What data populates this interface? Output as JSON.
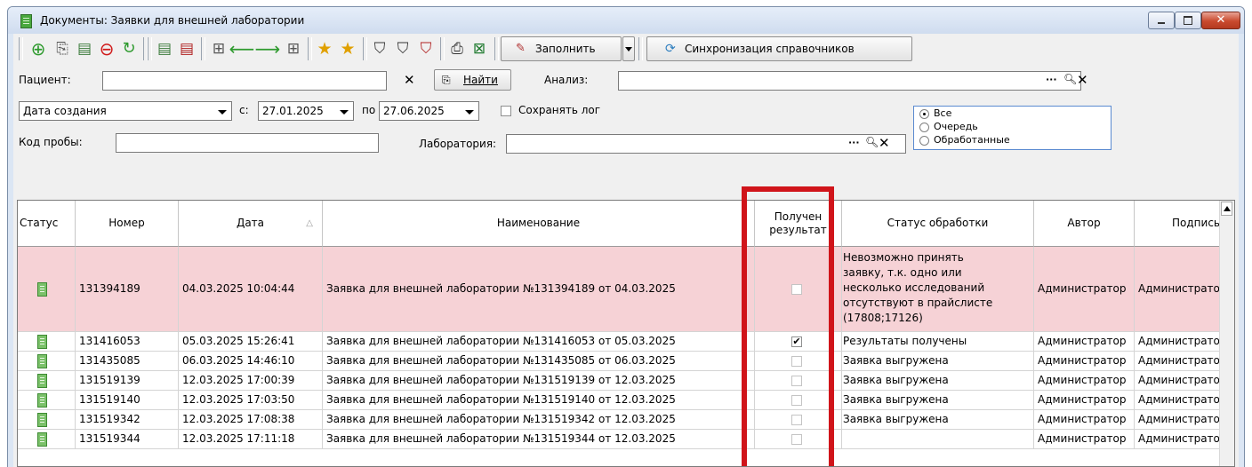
{
  "window": {
    "title": "Документы: Заявки для внешней лаборатории",
    "close_glyph": "✕"
  },
  "toolbar": {
    "fill_label": "Заполнить",
    "sync_label": "Синхронизация справочников"
  },
  "filters": {
    "patient_label": "Пациент:",
    "find_label": "Найти",
    "analysis_label": "Анализ:",
    "date_type": "Дата создания",
    "from_label": "с:",
    "from_date": "27.01.2025",
    "to_label": "по",
    "to_date": "27.06.2025",
    "save_log_label": "Сохранять лог",
    "sample_code_label": "Код пробы:",
    "lab_label": "Лаборатория:",
    "radio": {
      "all": "Все",
      "queue": "Очередь",
      "processed": "Обработанные"
    }
  },
  "grid": {
    "columns": {
      "status": "Статус",
      "number": "Номер",
      "date": "Дата",
      "name": "Наименование",
      "received_line1": "Получен",
      "received_line2": "результат",
      "processing": "Статус обработки",
      "author": "Автор",
      "signer": "Подпись"
    },
    "rows": [
      {
        "number": "131394189",
        "date": "04.03.2025 10:04:44",
        "name": "Заявка для внешней лаборатории №131394189 от 04.03.2025",
        "received": false,
        "processing_lines": [
          "Невозможно принять",
          "заявку, т.к. одно или",
          "несколько исследований",
          "отсутствуют в прайслисте",
          "(17808;17126)"
        ],
        "author": "Администратор",
        "signer": "Администратор"
      },
      {
        "number": "131416053",
        "date": "05.03.2025 15:26:41",
        "name": "Заявка для внешней лаборатории №131416053 от 05.03.2025",
        "received": true,
        "processing": "Результаты получены",
        "author": "Администратор",
        "signer": "Администратор"
      },
      {
        "number": "131435085",
        "date": "06.03.2025 14:46:10",
        "name": "Заявка для внешней лаборатории №131435085 от 06.03.2025",
        "received": false,
        "processing": "Заявка выгружена",
        "author": "Администратор",
        "signer": "Администратор"
      },
      {
        "number": "131519139",
        "date": "12.03.2025 17:00:39",
        "name": "Заявка для внешней лаборатории №131519139 от 12.03.2025",
        "received": false,
        "processing": "Заявка выгружена",
        "author": "Администратор",
        "signer": "Администратор"
      },
      {
        "number": "131519140",
        "date": "12.03.2025 17:03:50",
        "name": "Заявка для внешней лаборатории №131519140 от 12.03.2025",
        "received": false,
        "processing": "Заявка выгружена",
        "author": "Администратор",
        "signer": "Администратор"
      },
      {
        "number": "131519342",
        "date": "12.03.2025 17:08:38",
        "name": "Заявка для внешней лаборатории №131519342 от 12.03.2025",
        "received": false,
        "processing": "Заявка выгружена",
        "author": "Администратор",
        "signer": "Администратор"
      },
      {
        "number": "131519344",
        "date": "12.03.2025 17:11:18",
        "name": "Заявка для внешней лаборатории №131519344 от 12.03.2025",
        "received": false,
        "processing": "",
        "author": "Администратор",
        "signer": "Администратор"
      }
    ]
  }
}
